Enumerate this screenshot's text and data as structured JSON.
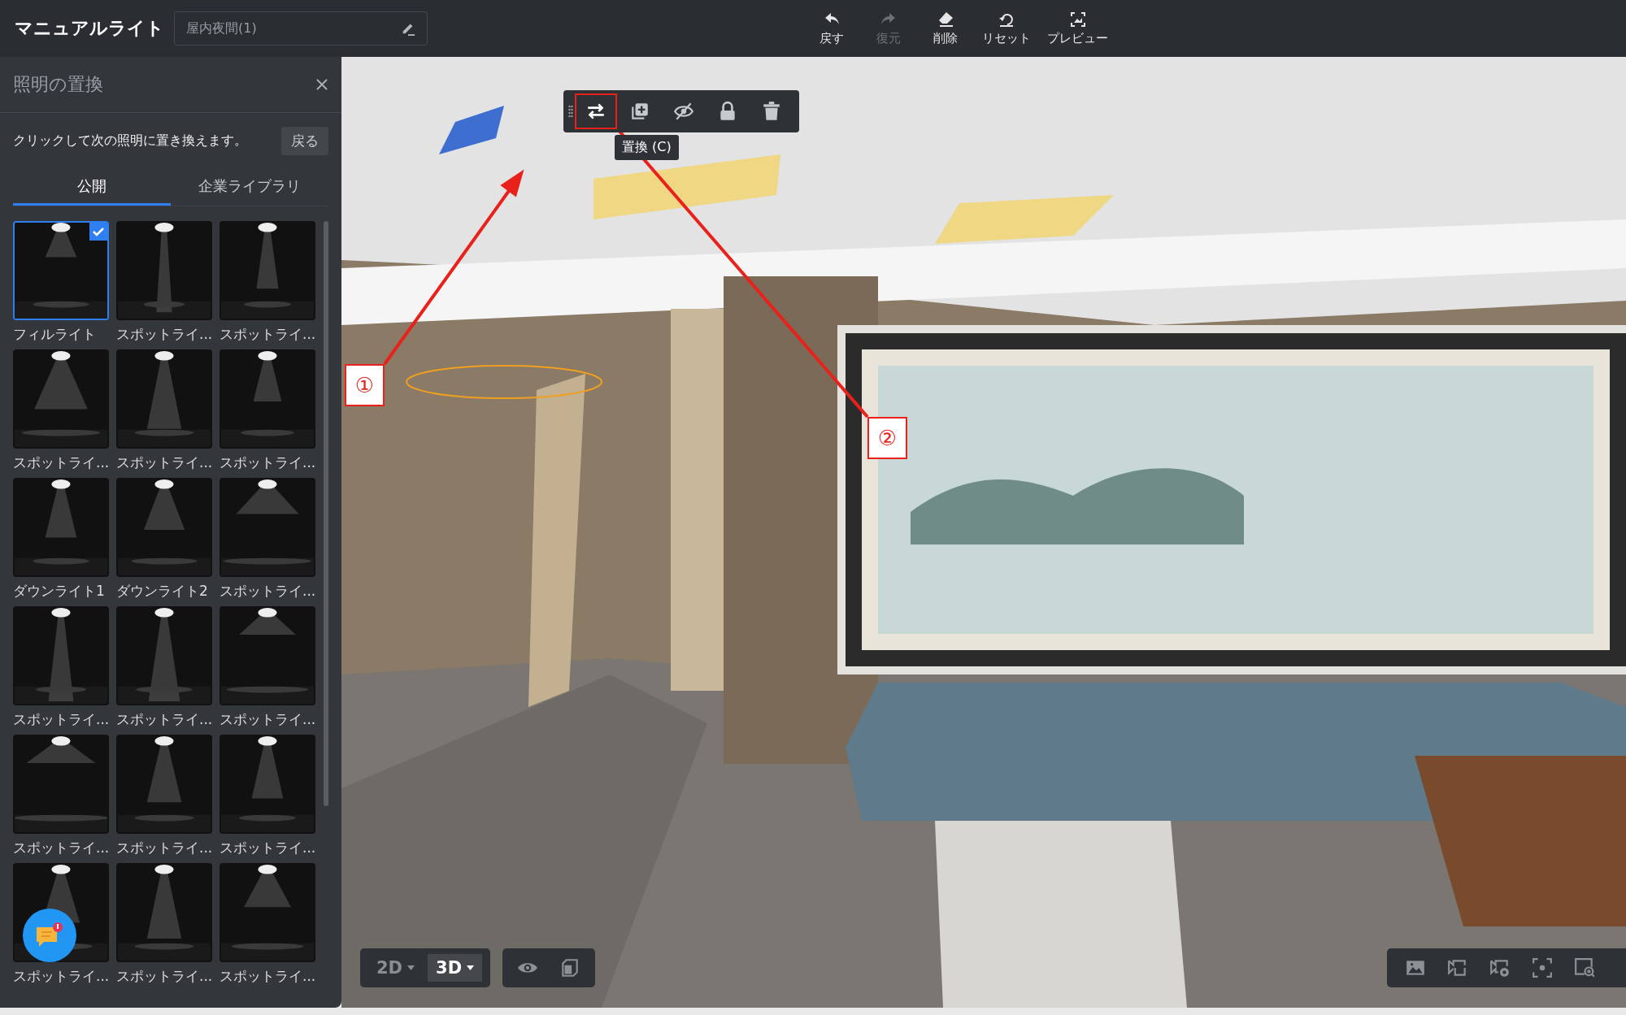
{
  "header": {
    "title": "マニュアルライト",
    "scene_name": "屋内夜間(1)",
    "toolbar": [
      {
        "label": "戻す",
        "kind": "undo",
        "disabled": false
      },
      {
        "label": "復元",
        "kind": "redo",
        "disabled": true
      },
      {
        "label": "削除",
        "kind": "erase",
        "disabled": false
      },
      {
        "label": "リセット",
        "kind": "reset",
        "disabled": false
      },
      {
        "label": "プレビュー",
        "kind": "preview",
        "disabled": false
      }
    ]
  },
  "panel": {
    "title": "照明の置換",
    "instruction": "クリックして次の照明に置き換えます。",
    "back_button": "戻る",
    "tabs": [
      {
        "label": "公開",
        "selected": true
      },
      {
        "label": "企業ライブラリ",
        "selected": false
      }
    ],
    "lights": [
      {
        "name": "フィルライト",
        "selected": true
      },
      {
        "name": "スポットライ...",
        "selected": false
      },
      {
        "name": "スポットライ...",
        "selected": false
      },
      {
        "name": "スポットライ...",
        "selected": false
      },
      {
        "name": "スポットライ...",
        "selected": false
      },
      {
        "name": "スポットライ...",
        "selected": false
      },
      {
        "name": "ダウンライト1",
        "selected": false
      },
      {
        "name": "ダウンライト2",
        "selected": false
      },
      {
        "name": "スポットライ...",
        "selected": false
      },
      {
        "name": "スポットライ...",
        "selected": false
      },
      {
        "name": "スポットライ...",
        "selected": false
      },
      {
        "name": "スポットライ...",
        "selected": false
      },
      {
        "name": "スポットライ...",
        "selected": false
      },
      {
        "name": "スポットライ...",
        "selected": false
      },
      {
        "name": "スポットライ...",
        "selected": false
      },
      {
        "name": "スポットライ...",
        "selected": false
      },
      {
        "name": "スポットライ...",
        "selected": false
      },
      {
        "name": "スポットライ...",
        "selected": false
      }
    ]
  },
  "viewport": {
    "object_toolbar": [
      {
        "kind": "replace",
        "highlighted": true
      },
      {
        "kind": "copy",
        "highlighted": false
      },
      {
        "kind": "hide",
        "highlighted": false
      },
      {
        "kind": "lock",
        "highlighted": false
      },
      {
        "kind": "delete",
        "highlighted": false
      }
    ],
    "tooltip": "置換 (C)",
    "callouts": [
      "①",
      "②"
    ],
    "view_modes": [
      {
        "label": "2D",
        "selected": false
      },
      {
        "label": "3D",
        "selected": true
      }
    ]
  }
}
